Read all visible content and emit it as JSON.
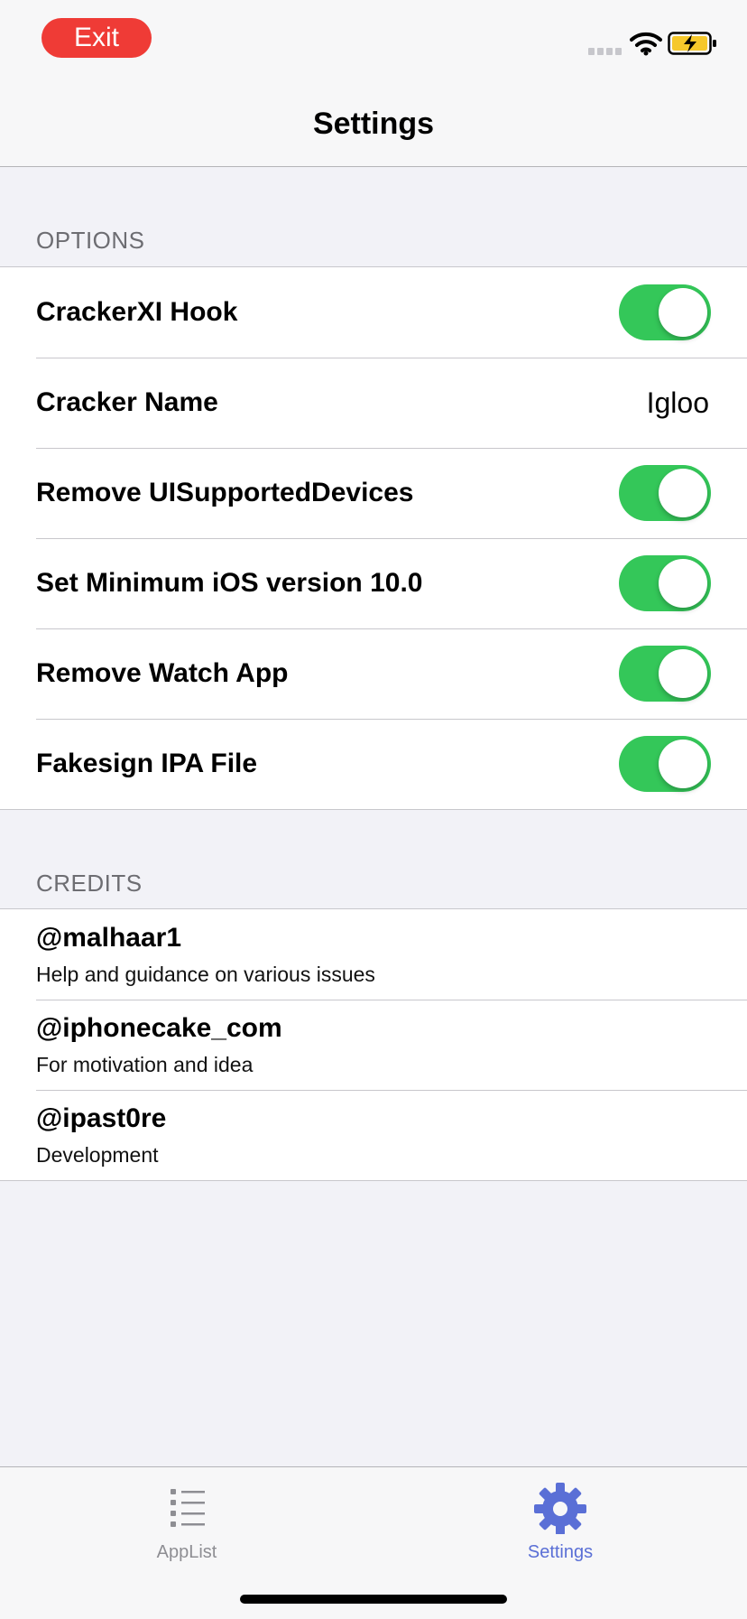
{
  "status_bar": {
    "exit_label": "Exit"
  },
  "nav": {
    "title": "Settings"
  },
  "options": {
    "header": "OPTIONS",
    "rows": [
      {
        "label": "CrackerXI Hook",
        "type": "toggle",
        "on": true
      },
      {
        "label": "Cracker Name",
        "type": "value",
        "value": "Igloo"
      },
      {
        "label": "Remove UISupportedDevices",
        "type": "toggle",
        "on": true
      },
      {
        "label": "Set Minimum iOS version 10.0",
        "type": "toggle",
        "on": true
      },
      {
        "label": "Remove Watch App",
        "type": "toggle",
        "on": true
      },
      {
        "label": "Fakesign IPA File",
        "type": "toggle",
        "on": true
      }
    ]
  },
  "credits": {
    "header": "CREDITS",
    "items": [
      {
        "handle": "@malhaar1",
        "description": "Help and guidance on various issues"
      },
      {
        "handle": "@iphonecake_com",
        "description": "For motivation and idea"
      },
      {
        "handle": "@ipast0re",
        "description": "Development"
      }
    ]
  },
  "tab_bar": {
    "tabs": [
      {
        "label": "AppList",
        "icon": "list-icon",
        "selected": false
      },
      {
        "label": "Settings",
        "icon": "gear-icon",
        "selected": true
      }
    ]
  },
  "colors": {
    "exit_button": "#ef3b36",
    "toggle_on": "#34c759",
    "tab_active": "#5a6fd6",
    "tab_inactive": "#8e8e93",
    "battery_fill": "#f6c82b"
  }
}
